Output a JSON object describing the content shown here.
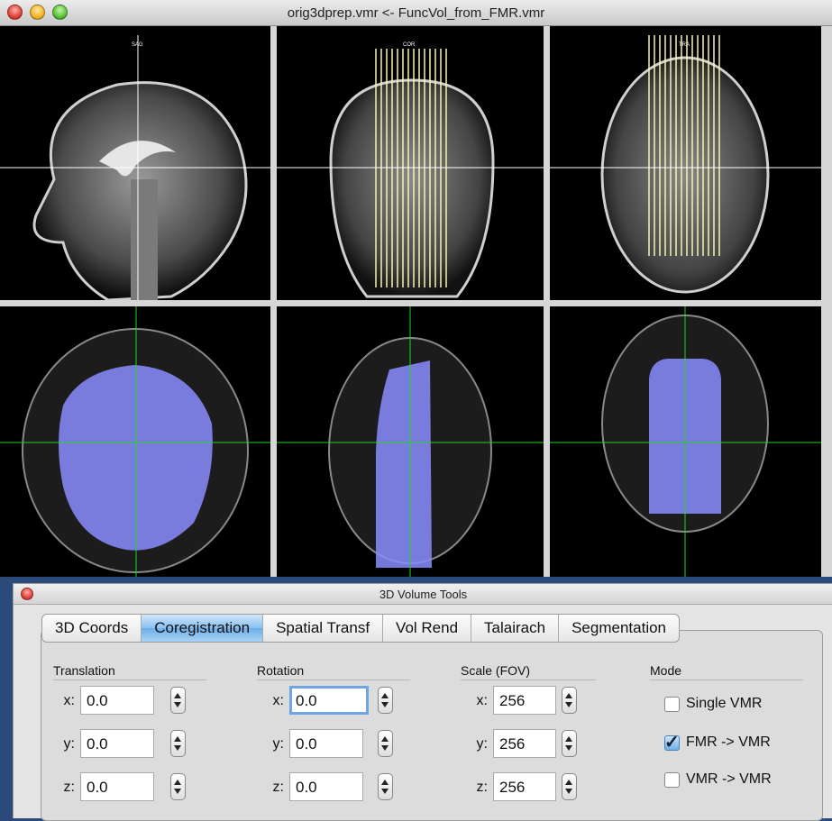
{
  "window": {
    "title": "orig3dprep.vmr  <-  FuncVol_from_FMR.vmr"
  },
  "views": {
    "top": [
      {
        "label": "SAG"
      },
      {
        "label": "COR"
      },
      {
        "label": "TRA"
      }
    ]
  },
  "tools": {
    "title": "3D Volume Tools",
    "tabs": [
      "3D Coords",
      "Coregistration",
      "Spatial Transf",
      "Vol Rend",
      "Talairach",
      "Segmentation"
    ],
    "active_tab": "Coregistration",
    "translation": {
      "label": "Translation",
      "x": "0.0",
      "y": "0.0",
      "z": "0.0"
    },
    "rotation": {
      "label": "Rotation",
      "x": "0.0",
      "y": "0.0",
      "z": "0.0"
    },
    "scale": {
      "label": "Scale (FOV)",
      "x": "256",
      "y": "256",
      "z": "256"
    },
    "axis_labels": {
      "x": "x:",
      "y": "y:",
      "z": "z:"
    },
    "mode": {
      "label": "Mode",
      "options": [
        {
          "label": "Single VMR",
          "checked": false
        },
        {
          "label": "FMR -> VMR",
          "checked": true
        },
        {
          "label": "VMR -> VMR",
          "checked": false
        }
      ]
    }
  },
  "colors": {
    "overlay": "#8a8cff",
    "crosshair_top": "#ffffff",
    "crosshair_bottom": "#22d422",
    "slice_lines": "#f5f5b0"
  }
}
